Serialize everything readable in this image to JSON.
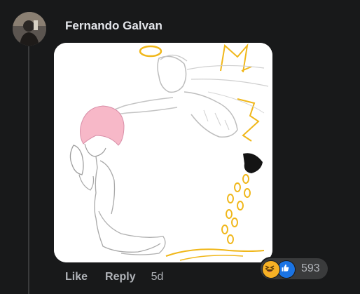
{
  "comment": {
    "author": "Fernando Galvan",
    "actions": {
      "like": "Like",
      "reply": "Reply",
      "time": "5d"
    },
    "reactions": {
      "icons": [
        "haha-emoji-icon",
        "thumbs-up-icon"
      ],
      "count": "593"
    }
  },
  "colors": {
    "background": "#18191a",
    "author_text": "#e4e6eb",
    "secondary_text": "#b0b3b8",
    "reaction_pill": "#3a3b3c",
    "like_blue": "#1b74e4",
    "haha_yellow": "#f7b125"
  }
}
